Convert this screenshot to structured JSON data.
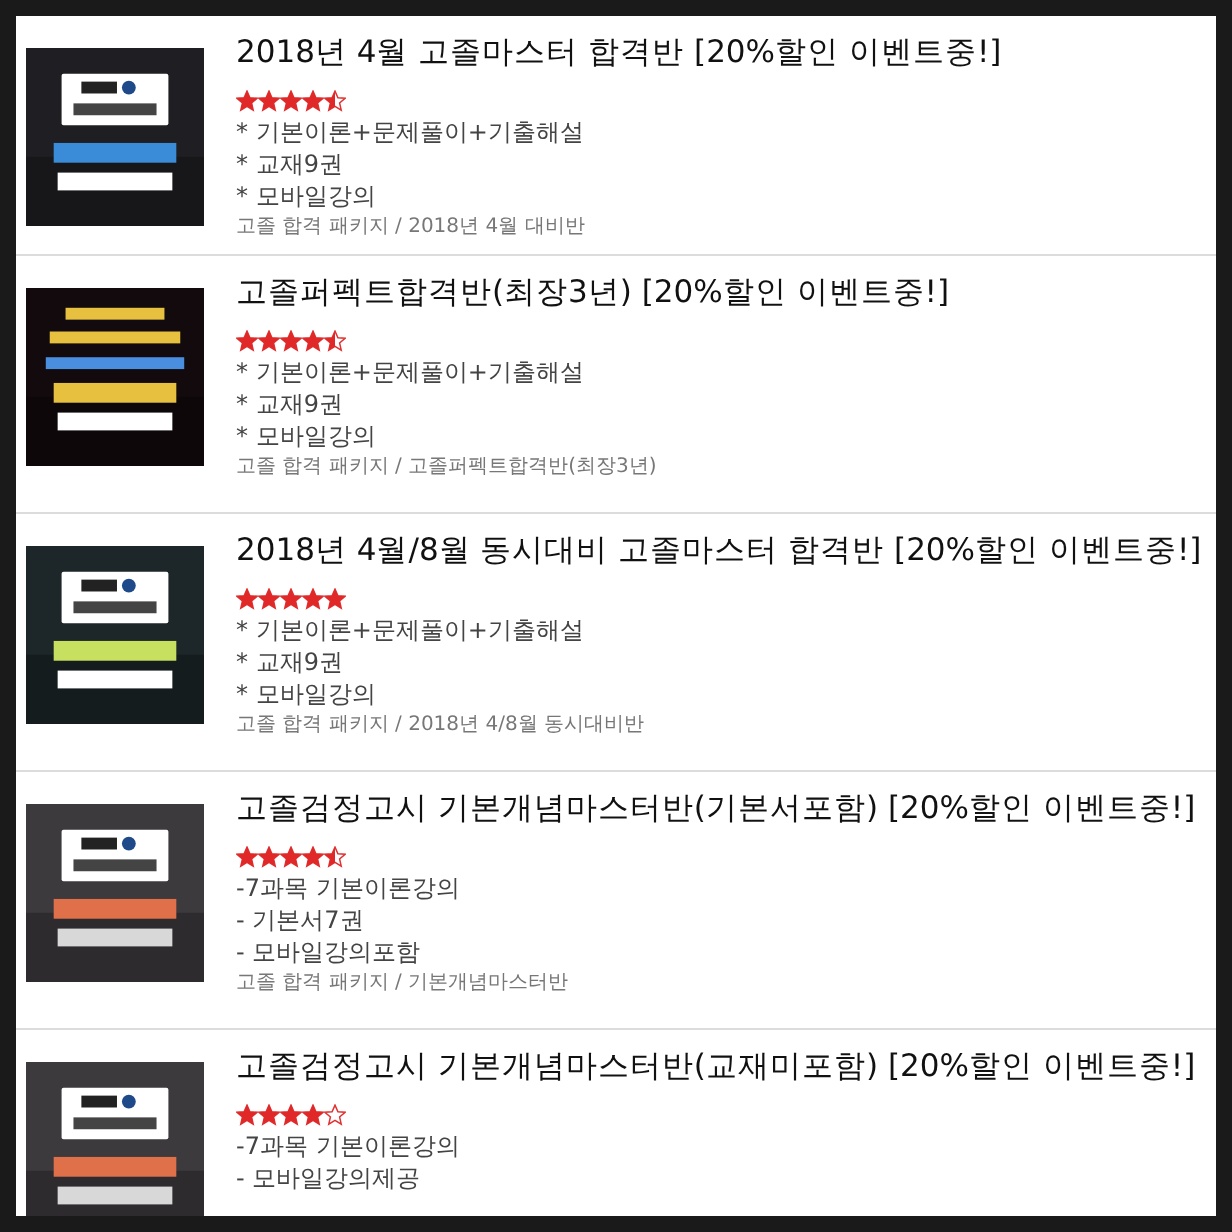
{
  "products": [
    {
      "thumbnail": {
        "kind": "picture"
      },
      "title": "2018년 4월 고졸마스터 합격반 [20%할인 이벤트중!]",
      "stars": 4.5,
      "features": [
        "* 기본이론+문제풀이+기출해설",
        "* 교재9권",
        "* 모바일강의"
      ],
      "breadcrumb": "고졸 합격 패키지 / 2018년 4월 대비반"
    },
    {
      "thumbnail": {
        "kind": "picture"
      },
      "title": "고졸퍼펙트합격반(최장3년) [20%할인 이벤트중!]",
      "stars": 4.5,
      "features": [
        "* 기본이론+문제풀이+기출해설",
        "* 교재9권",
        "* 모바일강의"
      ],
      "breadcrumb": "고졸 합격 패키지 / 고졸퍼펙트합격반(최장3년)"
    },
    {
      "thumbnail": {
        "kind": "picture"
      },
      "title": "2018년 4월/8월 동시대비 고졸마스터 합격반 [20%할인 이벤트중!]",
      "stars": 5,
      "features": [
        "* 기본이론+문제풀이+기출해설",
        "* 교재9권",
        "* 모바일강의"
      ],
      "breadcrumb": "고졸 합격 패키지 / 2018년 4/8월 동시대비반"
    },
    {
      "thumbnail": {
        "kind": "picture"
      },
      "title": "고졸검정고시 기본개념마스터반(기본서포함) [20%할인 이벤트중!]",
      "stars": 4.5,
      "features": [
        "-7과목 기본이론강의",
        "- 기본서7권",
        "- 모바일강의포함"
      ],
      "breadcrumb": "고졸 합격 패키지 / 기본개념마스터반"
    },
    {
      "thumbnail": {
        "kind": "picture"
      },
      "title": "고졸검정고시 기본개념마스터반(교재미포함) [20%할인 이벤트중!]",
      "stars": 4,
      "features": [
        "-7과목 기본이론강의",
        "- 모바일강의제공"
      ]
    }
  ]
}
